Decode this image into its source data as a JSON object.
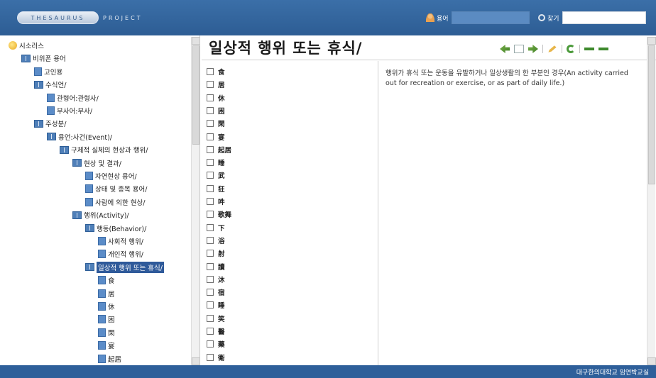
{
  "header": {
    "logo_pill": "THESAURUS",
    "logo_word": "PROJECT",
    "search1_label": "용어",
    "search2_label": "찾기",
    "search1_value": "",
    "search2_value": ""
  },
  "tree": [
    {
      "label": "시소러스",
      "level": 0,
      "icon": "root"
    },
    {
      "label": "비위폰 용어",
      "level": 1,
      "icon": "book"
    },
    {
      "label": "고인용",
      "level": 2,
      "icon": "leaf"
    },
    {
      "label": "수식언/",
      "level": 2,
      "icon": "book"
    },
    {
      "label": "관형어:관형사/",
      "level": 3,
      "icon": "leaf"
    },
    {
      "label": "부사어:부사/",
      "level": 3,
      "icon": "leaf"
    },
    {
      "label": "주성분/",
      "level": 2,
      "icon": "book"
    },
    {
      "label": "용언:사건(Event)/",
      "level": 3,
      "icon": "book"
    },
    {
      "label": "구체적 실체의 현상과 행위/",
      "level": 4,
      "icon": "book"
    },
    {
      "label": "현상 및 결과/",
      "level": 5,
      "icon": "book"
    },
    {
      "label": "자연현상 용어/",
      "level": 6,
      "icon": "leaf"
    },
    {
      "label": "상태 및 종목 용어/",
      "level": 6,
      "icon": "leaf"
    },
    {
      "label": "사람에 의한 현상/",
      "level": 6,
      "icon": "leaf"
    },
    {
      "label": "행위(Activity)/",
      "level": 5,
      "icon": "book"
    },
    {
      "label": "행동(Behavior)/",
      "level": 6,
      "icon": "book"
    },
    {
      "label": "사회적 행위/",
      "level": 7,
      "icon": "leaf"
    },
    {
      "label": "개인적 행위/",
      "level": 7,
      "icon": "leaf"
    },
    {
      "label": "일상적 행위 또는 휴식/",
      "level": 6,
      "icon": "book",
      "selected": true
    },
    {
      "label": "食",
      "level": 7,
      "icon": "leaf"
    },
    {
      "label": "居",
      "level": 7,
      "icon": "leaf"
    },
    {
      "label": "休",
      "level": 7,
      "icon": "leaf"
    },
    {
      "label": "困",
      "level": 7,
      "icon": "leaf"
    },
    {
      "label": "閑",
      "level": 7,
      "icon": "leaf"
    },
    {
      "label": "宴",
      "level": 7,
      "icon": "leaf"
    },
    {
      "label": "起居",
      "level": 7,
      "icon": "leaf"
    }
  ],
  "main": {
    "title": "일상적 행위 또는 휴식/",
    "terms": [
      "食",
      "居",
      "休",
      "困",
      "閑",
      "宴",
      "起居",
      "睡",
      "武",
      "狂",
      "吽",
      "歌舞",
      "下",
      "浴",
      "射",
      "讀",
      "沐",
      "宿",
      "睡",
      "笑",
      "醫",
      "藥",
      "衛"
    ],
    "description": "행위가 휴식 또는 운동을 유발하거나 일상생활의 한 부분인 경우(An activity carried out for recreation or exercise, or as part of daily life.)"
  },
  "footer": {
    "text": "대구한의대학교 임연박교실"
  }
}
